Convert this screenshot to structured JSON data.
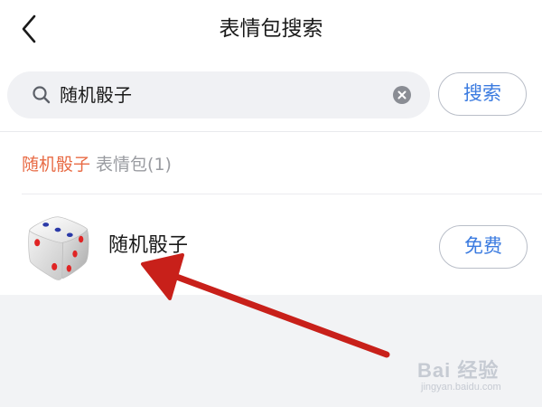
{
  "header": {
    "back_icon": "chevron-left-icon",
    "title": "表情包搜索"
  },
  "search": {
    "icon": "search-icon",
    "value": "随机骰子",
    "clear_icon": "clear-icon",
    "button_label": "搜索"
  },
  "results_section": {
    "query": "随机骰子",
    "suffix": " 表情包(1)"
  },
  "results": [
    {
      "icon": "dice-icon",
      "name": "随机骰子",
      "action_label": "免费"
    }
  ],
  "annotation": {
    "arrow_color": "#c8201a"
  },
  "watermark": {
    "text": "Bai 经验",
    "sub": "jingyan.baidu.com"
  },
  "colors": {
    "accent_blue": "#3b7be0",
    "accent_orange": "#e86b45",
    "muted_text": "#9a9ca1"
  }
}
